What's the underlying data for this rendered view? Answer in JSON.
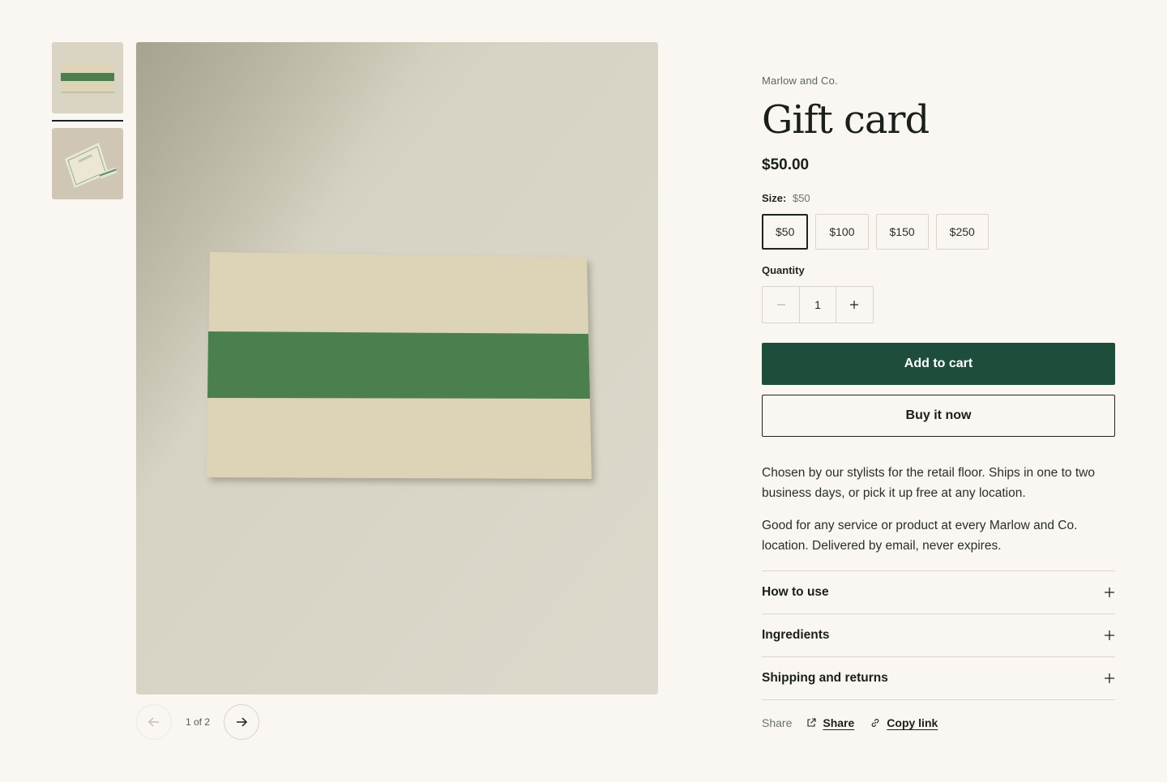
{
  "gallery": {
    "thumbnail_count": 2,
    "active_thumbnail": 1,
    "counter": "1 of 2",
    "prev_icon": "arrow-left-icon",
    "next_icon": "arrow-right-icon"
  },
  "product": {
    "vendor": "Marlow and Co.",
    "title": "Gift card",
    "price": "$50.00",
    "size_label": "Size:",
    "size_value": "$50",
    "sizes": [
      "$50",
      "$100",
      "$150",
      "$250"
    ],
    "selected_size": "$50",
    "quantity_label": "Quantity",
    "quantity": "1",
    "add_to_cart": "Add to cart",
    "buy_now": "Buy it now",
    "description": [
      "Chosen by our stylists for the retail floor. Ships in one to two business days, or pick it up free at any location.",
      "Good for any service or product at every Marlow and Co. location. Delivered by email, never expires."
    ],
    "accordion": [
      "How to use",
      "Ingredients",
      "Shipping and returns"
    ],
    "share": {
      "label": "Share",
      "share_link": "Share",
      "copy_link": "Copy link"
    }
  },
  "colors": {
    "background": "#faf7f2",
    "accent": "#1e4d3c",
    "card_green": "#4c7f4e",
    "card_cream": "#ddd3b6"
  }
}
